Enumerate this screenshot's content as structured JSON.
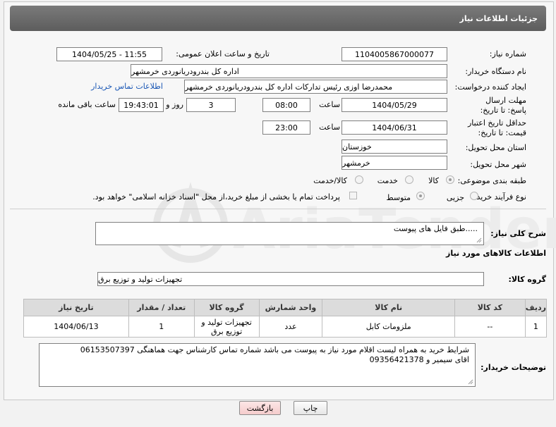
{
  "header": {
    "title": "جزئیات اطلاعات نیاز"
  },
  "watermark": {
    "text": "AriaTender.net"
  },
  "form": {
    "need_number_label": "شماره نیاز:",
    "need_number": "1104005867000077",
    "announce_label": "تاریخ و ساعت اعلان عمومی:",
    "announce_value": "1404/05/25 - 11:55",
    "buyer_org_label": "نام دستگاه خریدار:",
    "buyer_org": "اداره کل بندرودریانوردی خرمشهر",
    "creator_label": "ایجاد کننده درخواست:",
    "creator": "محمدرضا اوزی رئیس تدارکات اداره کل بندرودریانوردی خرمشهر",
    "buyer_contact_link": "اطلاعات تماس خریدار",
    "deadline_label": "مهلت ارسال پاسخ: تا تاریخ:",
    "deadline_date": "1404/05/29",
    "time_label": "ساعت",
    "deadline_time": "08:00",
    "days_value": "3",
    "days_label": "روز و",
    "remaining_time": "19:43:01",
    "remaining_label": "ساعت باقی مانده",
    "price_validity_label": "حداقل تاریخ اعتبار قیمت: تا تاریخ:",
    "price_validity_date": "1404/06/31",
    "price_validity_time": "23:00",
    "province_label": "استان محل تحویل:",
    "province": "خوزستان",
    "city_label": "شهر محل تحویل:",
    "city": "خرمشهر",
    "category_label": "طبقه بندی موضوعی:",
    "category_options": [
      "کالا",
      "خدمت",
      "کالا/خدمت"
    ],
    "category_selected": "کالا",
    "process_label": "نوع فرآیند خرید :",
    "process_options": [
      "جزیی",
      "متوسط"
    ],
    "process_selected": "متوسط",
    "payment_note": "پرداخت تمام یا بخشی از مبلغ خرید،از محل \"اسناد خزانه اسلامی\" خواهد بود."
  },
  "description": {
    "label": "شرح کلی نیاز:",
    "text": ".....طبق فایل های پیوست"
  },
  "goods_section": {
    "title": "اطلاعات کالاهای مورد نیاز",
    "group_label": "گروه کالا:",
    "group_value": "تجهیزات تولید و توزیع برق"
  },
  "table": {
    "headers": [
      "ردیف",
      "کد کالا",
      "نام کالا",
      "واحد شمارش",
      "گروه کالا",
      "تعداد / مقدار",
      "تاریخ نیاز"
    ],
    "rows": [
      {
        "row": "1",
        "code": "--",
        "name": "ملزومات کابل",
        "unit": "عدد",
        "group": "تجهیزات تولید و توزیع برق",
        "qty": "1",
        "date": "1404/06/13"
      }
    ]
  },
  "buyer_notes": {
    "label": "توضیحات خریدار:",
    "line1": "شرایط خرید به همراه لیست اقلام مورد نیاز به پیوست می باشد شماره تماس کارشناس جهت هماهنگی 06153507397",
    "line2": "اقای سیمیر  و 09356421378"
  },
  "buttons": {
    "print": "چاپ",
    "back": "بازگشت"
  }
}
